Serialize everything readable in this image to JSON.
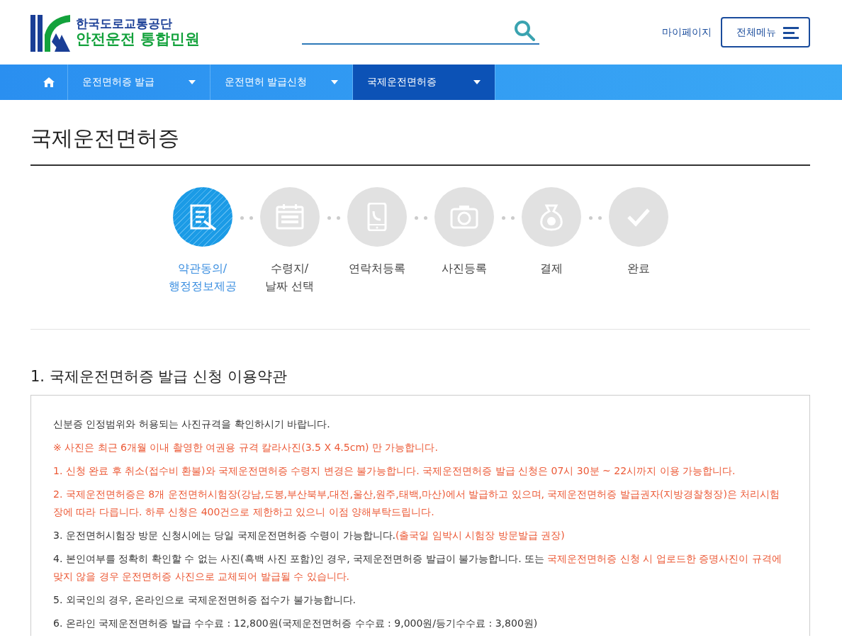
{
  "header": {
    "logo_top": "한국도로교통공단",
    "logo_bottom": "안전운전 통합민원",
    "mypage": "마이페이지",
    "menu_button": "전체메뉴"
  },
  "nav": [
    {
      "label": "운전면허증 발급",
      "selected": false
    },
    {
      "label": "운전면허 발급신청",
      "selected": false
    },
    {
      "label": "국제운전면허증",
      "selected": true
    }
  ],
  "page_title": "국제운전면허증",
  "steps": [
    {
      "label": [
        "약관동의/",
        "행정정보제공"
      ],
      "selected": true
    },
    {
      "label": [
        "수령지/",
        "날짜 선택"
      ],
      "selected": false
    },
    {
      "label": [
        "연락처등록"
      ],
      "selected": false
    },
    {
      "label": [
        "사진등록"
      ],
      "selected": false
    },
    {
      "label": [
        "결제"
      ],
      "selected": false
    },
    {
      "label": [
        "완료"
      ],
      "selected": false
    }
  ],
  "section_title": "1. 국제운전면허증 발급 신청 이용약관",
  "terms": [
    [
      {
        "kind": "plain",
        "text": "신분증 인정범위와 허용되는 사진규격을 확인하시기 바랍니다."
      }
    ],
    [
      {
        "kind": "warn",
        "text": "※ 사진은 최근 6개월 이내 촬영한 여권용 규격 칼라사진(3.5 X 4.5cm) 만 가능합니다."
      }
    ],
    [
      {
        "kind": "warn",
        "text": "1. 신청 완료 후 취소(접수비 환불)와 국제운전면허증 수령지 변경은 불가능합니다. 국제운전면허증 발급 신청은 07시 30분 ~ 22시까지 이용 가능합니다."
      }
    ],
    [
      {
        "kind": "warn",
        "text": "2. 국제운전면허증은 8개 운전면허시험장(강남,도봉,부산북부,대전,울산,원주,태백,마산)에서 발급하고 있으며, 국제운전면허증 발급권자(지방경찰청장)은 처리시험장에 따라 다릅니다. 하루 신청은 400건으로 제한하고 있으니 이점 양해부탁드립니다."
      }
    ],
    [
      {
        "kind": "plain",
        "text": "3. 운전면허시험장 방문 신청시에는 당일 국제운전면허증 수령이 가능합니다."
      },
      {
        "kind": "warn",
        "text": "(출국일 임박시 시험장 방문발급 권장)"
      }
    ],
    [
      {
        "kind": "plain",
        "text": "4. 본인여부를 정확히 확인할 수 없는 사진(흑백 사진 포함)인 경우, 국제운전면허증 발급이 불가능합니다. 또는 "
      },
      {
        "kind": "warn",
        "text": "국제운전면허증 신청 시 업로드한 증명사진이 규격에 맞지 않을 경우 운전면허증 사진으로 교체되어 발급될 수 있습니다."
      }
    ],
    [
      {
        "kind": "plain",
        "text": "5. 외국인의 경우, 온라인으로 국제운전면허증 접수가 불가능합니다."
      }
    ],
    [
      {
        "kind": "plain",
        "text": "6. 온라인 국제운전면허증 발급 수수료 : 12,800원(국제운전면허증 수수료 : 9,000원/등기수수료 : 3,800원)"
      }
    ]
  ]
}
